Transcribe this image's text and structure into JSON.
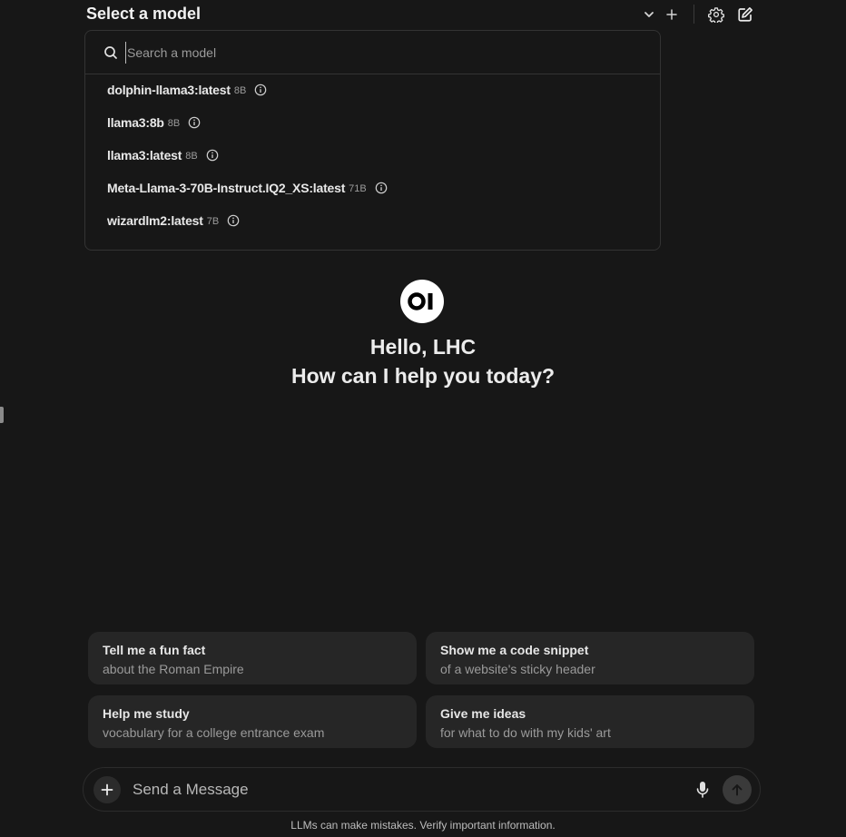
{
  "header": {
    "title": "Select a model",
    "icons": [
      "chevron-down-icon",
      "plus-icon",
      "gear-icon",
      "edit-icon"
    ]
  },
  "model_selector": {
    "search_placeholder": "Search a model",
    "models": [
      {
        "name": "dolphin-llama3:latest",
        "size": "8B"
      },
      {
        "name": "llama3:8b",
        "size": "8B"
      },
      {
        "name": "llama3:latest",
        "size": "8B"
      },
      {
        "name": "Meta-Llama-3-70B-Instruct.IQ2_XS:latest",
        "size": "71B"
      },
      {
        "name": "wizardlm2:latest",
        "size": "7B"
      }
    ]
  },
  "greeting": {
    "line1": "Hello, LHC",
    "line2": "How can I help you today?"
  },
  "suggestions": [
    {
      "title": "Tell me a fun fact",
      "subtitle": "about the Roman Empire"
    },
    {
      "title": "Show me a code snippet",
      "subtitle": "of a website's sticky header"
    },
    {
      "title": "Help me study",
      "subtitle": "vocabulary for a college entrance exam"
    },
    {
      "title": "Give me ideas",
      "subtitle": "for what to do with my kids' art"
    }
  ],
  "composer": {
    "placeholder": "Send a Message"
  },
  "footer": {
    "note": "LLMs can make mistakes. Verify important information."
  },
  "colors": {
    "background": "#171717",
    "card": "#262626",
    "text": "#ececec",
    "muted": "#9a9a9a"
  }
}
